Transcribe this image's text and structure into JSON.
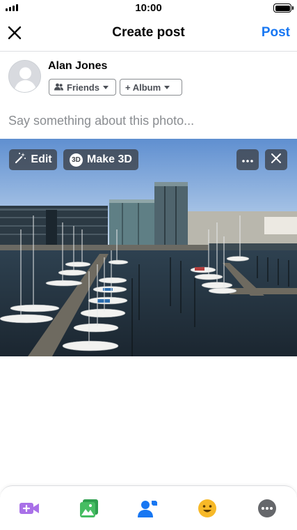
{
  "status_bar": {
    "time": "10:00"
  },
  "nav": {
    "title": "Create post",
    "post_label": "Post",
    "close_icon": "close-icon"
  },
  "composer": {
    "user_name": "Alan Jones",
    "audience_label": "Friends",
    "album_label": "+ Album",
    "caption_placeholder": "Say something about this photo..."
  },
  "photo_actions": {
    "edit_label": "Edit",
    "make3d_label": "Make 3D",
    "make3d_badge": "3D"
  },
  "toolbar": {
    "items": [
      {
        "name": "live-video-icon",
        "color": "#a971e8"
      },
      {
        "name": "photo-icon",
        "color": "#45bd62"
      },
      {
        "name": "tag-people-icon",
        "color": "#1877f2"
      },
      {
        "name": "feeling-icon",
        "color": "#f7b928"
      },
      {
        "name": "more-options-icon",
        "color": "#65676b"
      }
    ]
  },
  "colors": {
    "accent": "#1877f2",
    "placeholder": "#8a8d91",
    "divider": "#dddfe2"
  }
}
